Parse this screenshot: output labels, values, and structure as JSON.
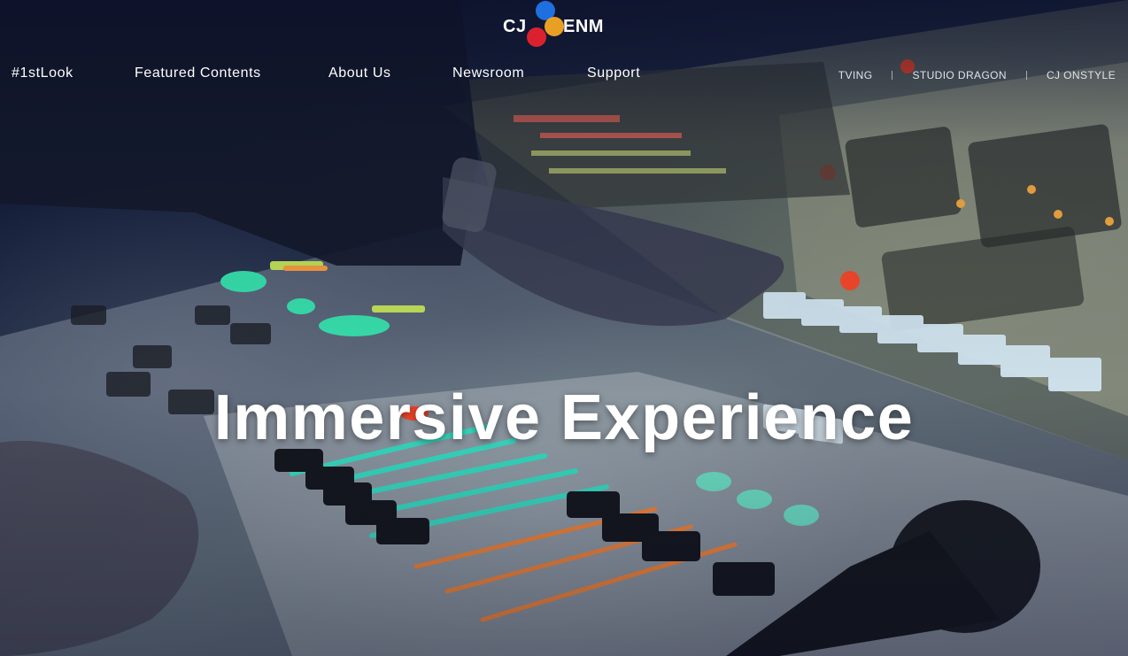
{
  "logo": {
    "left_text": "CJ",
    "right_text": "ENM",
    "mark_colors": [
      "#1e6fe0",
      "#f5a623",
      "#e8222e"
    ]
  },
  "main_nav": [
    {
      "label": "#1stLook"
    },
    {
      "label": "Featured Contents"
    },
    {
      "label": "About Us"
    },
    {
      "label": "Newsroom"
    },
    {
      "label": "Support"
    }
  ],
  "affiliates": [
    {
      "label": "TVING"
    },
    {
      "label": "STUDIO DRAGON"
    },
    {
      "label": "CJ ONSTYLE"
    }
  ],
  "hero": {
    "headline": "Immersive Experience"
  },
  "colors": {
    "text": "#ffffff",
    "led_green": "#39e6b0",
    "led_red": "#ff4a2a",
    "led_white": "#dff4ff"
  }
}
